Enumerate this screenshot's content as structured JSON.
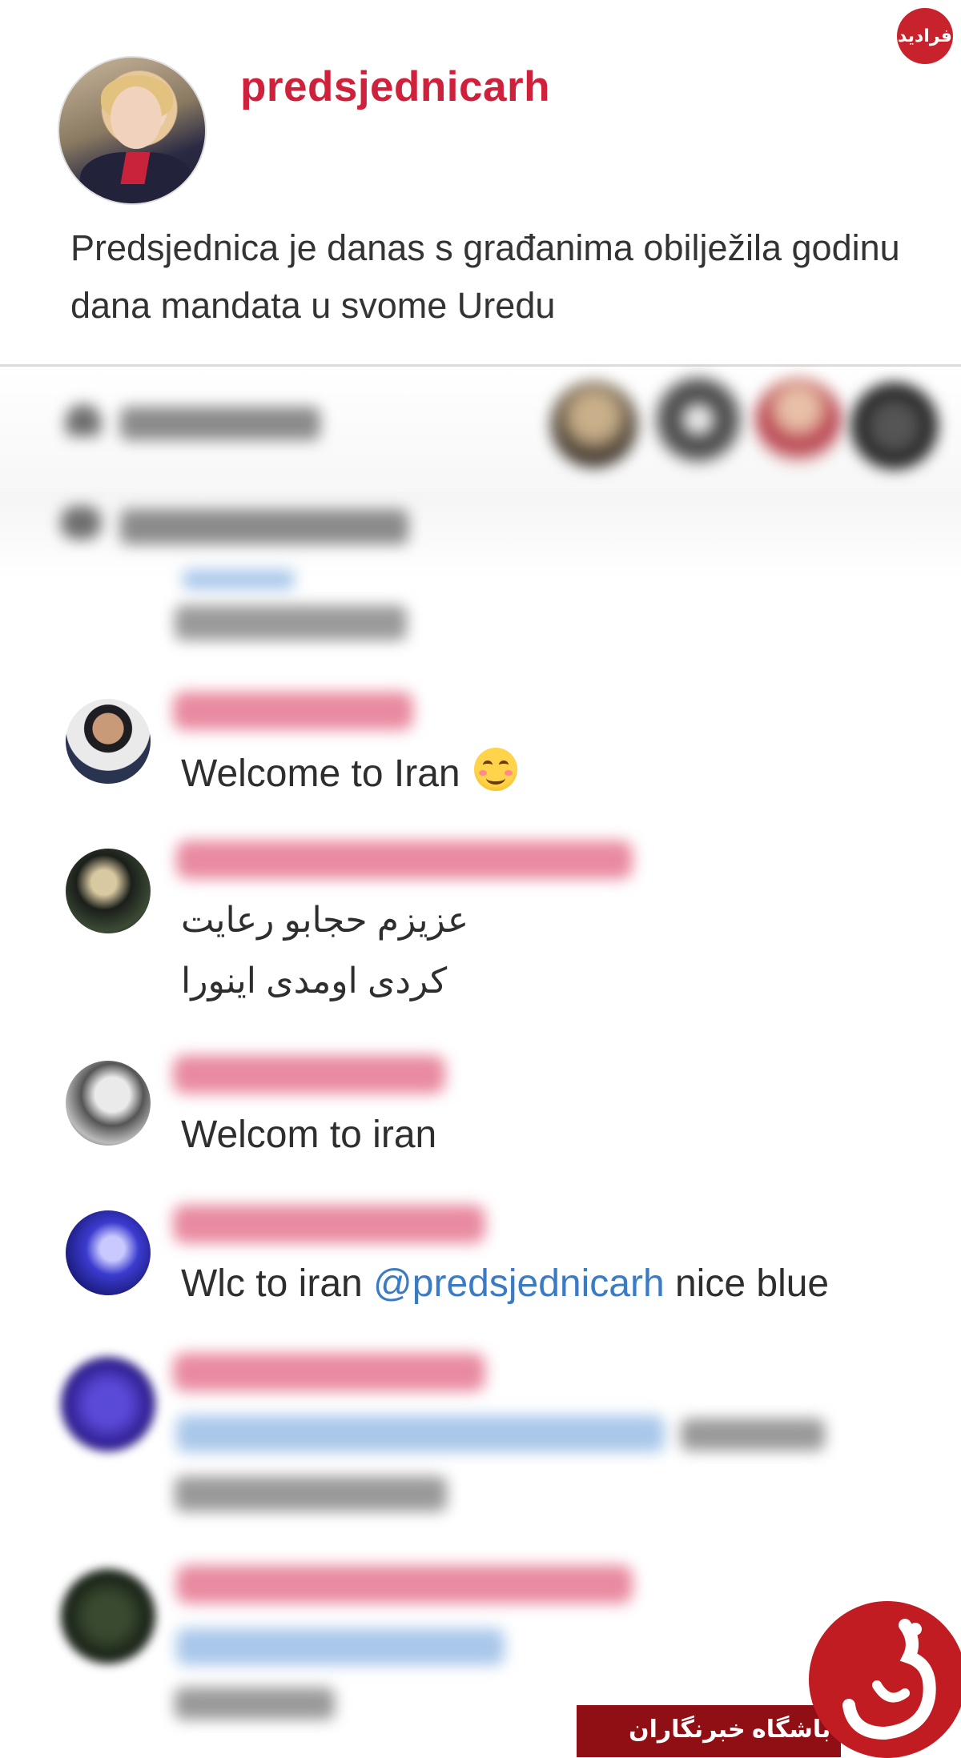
{
  "post": {
    "username": "predsjednicarh",
    "caption": "Predsjednica je danas s građanima obilježila godinu dana mandata u svome Uredu"
  },
  "comments": [
    {
      "text": "Welcome to Iran"
    },
    {
      "line1": "عزیزم حجابو رعایت",
      "line2": "کردی اومدی اینورا"
    },
    {
      "text": "Welcom to iran"
    },
    {
      "prefix": "Wlc to iran ",
      "mention": "@predsjednicarh",
      "suffix": " nice blue"
    }
  ],
  "watermarks": {
    "top_logo": "فرادید",
    "bottom_banner": "باشگاه خبرنگاران"
  },
  "colors": {
    "username": "#d0213c",
    "mention": "#3b7bc4",
    "banner": "#8f0f14",
    "emblem": "#c11c22"
  }
}
